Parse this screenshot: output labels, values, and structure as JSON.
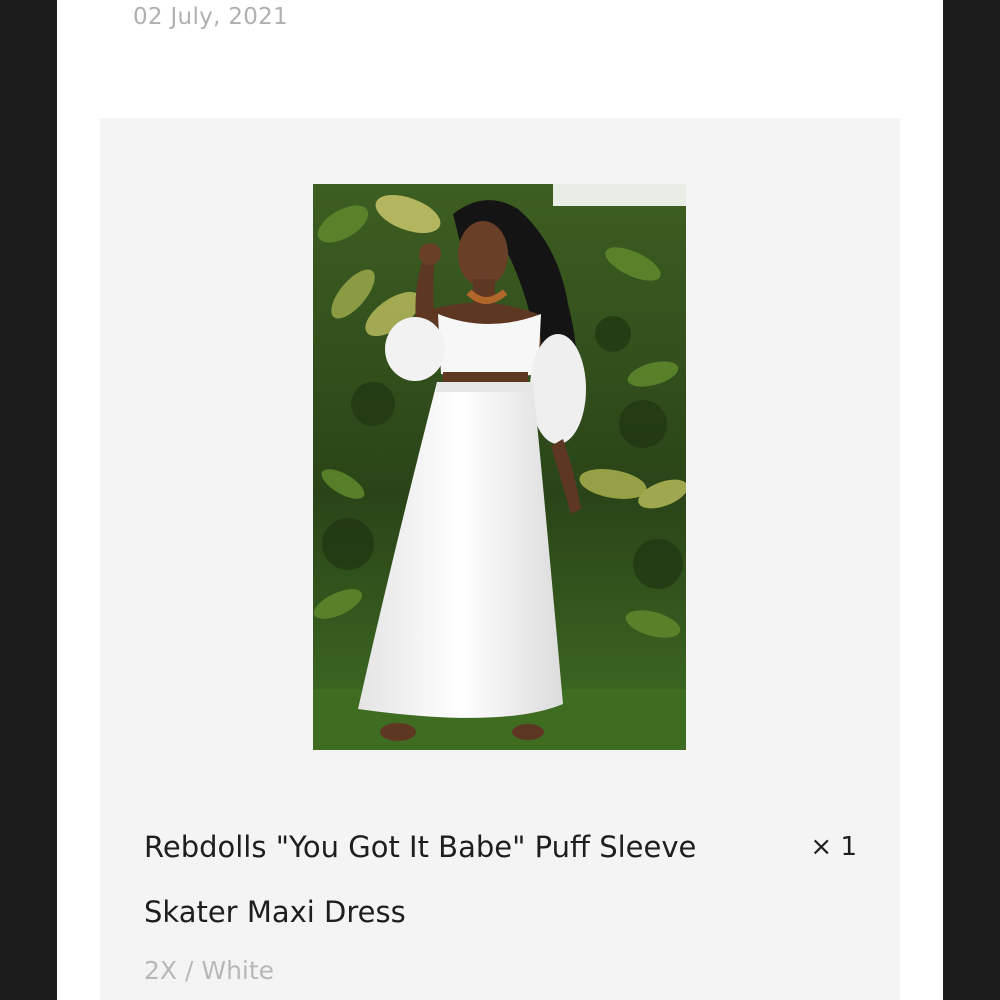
{
  "order": {
    "date": "02 July, 2021"
  },
  "line_item": {
    "image_description_icon": "product-photo",
    "title": "Rebdolls \"You Got It Babe\" Puff Sleeve Skater Maxi Dress",
    "quantity": "× 1",
    "variant": "2X / White"
  },
  "colors": {
    "background_dark": "#1c1c1c",
    "page": "#ffffff",
    "card": "#f4f4f4",
    "text_primary": "#1e1e1e",
    "text_muted": "#b0b0b0"
  }
}
